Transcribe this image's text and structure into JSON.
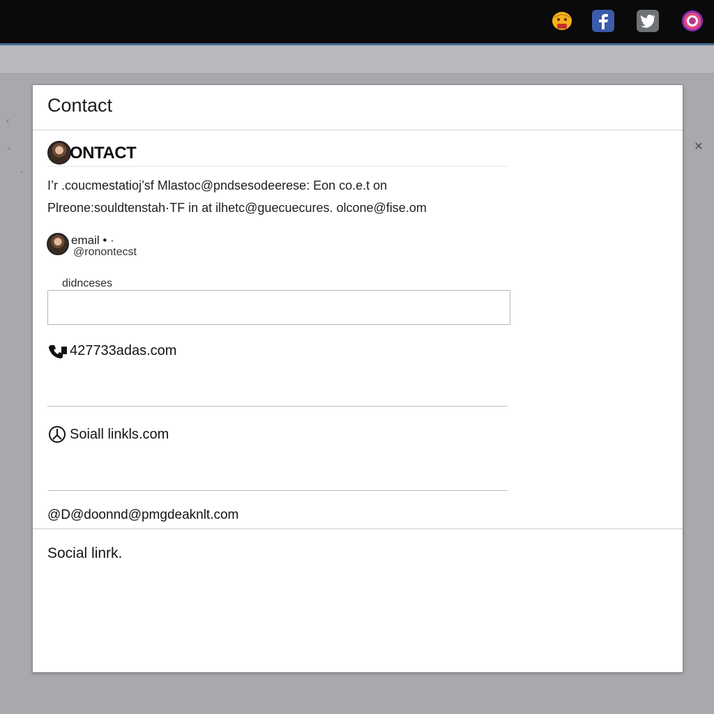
{
  "top_bar": {
    "icons": [
      "emoji-icon",
      "facebook-icon",
      "twitter-icon",
      "instagram-icon"
    ]
  },
  "modal": {
    "title": "Contact",
    "section_heading": "ONTACT",
    "description_line1": "I’r .coucmestatioj’sf  Mlastoc@pndsesodeerese:   Eon co.e.t on",
    "description_line2": "Plreone:souldtenstah·TF in at ilhetc@guecuecures. olcone@fise.om",
    "email": {
      "label": "email  •  ·",
      "sub": "@ronontecst"
    },
    "input": {
      "label": "didnceses",
      "value": "",
      "placeholder": ""
    },
    "phone_row": "427733adas.com",
    "social_row": "Soiall linkls.com",
    "contact_row": "@D@doonnd@pmgdeaknlt.com",
    "footer_label": "Social linrk."
  },
  "colors": {
    "top_bar": "#0a0a0a",
    "top_bar_accent": "#3f6f95",
    "backdrop": "#a9a9ad",
    "modal_bg": "#ffffff",
    "facebook": "#3b5bab",
    "instagram": "#8b2fb5"
  }
}
